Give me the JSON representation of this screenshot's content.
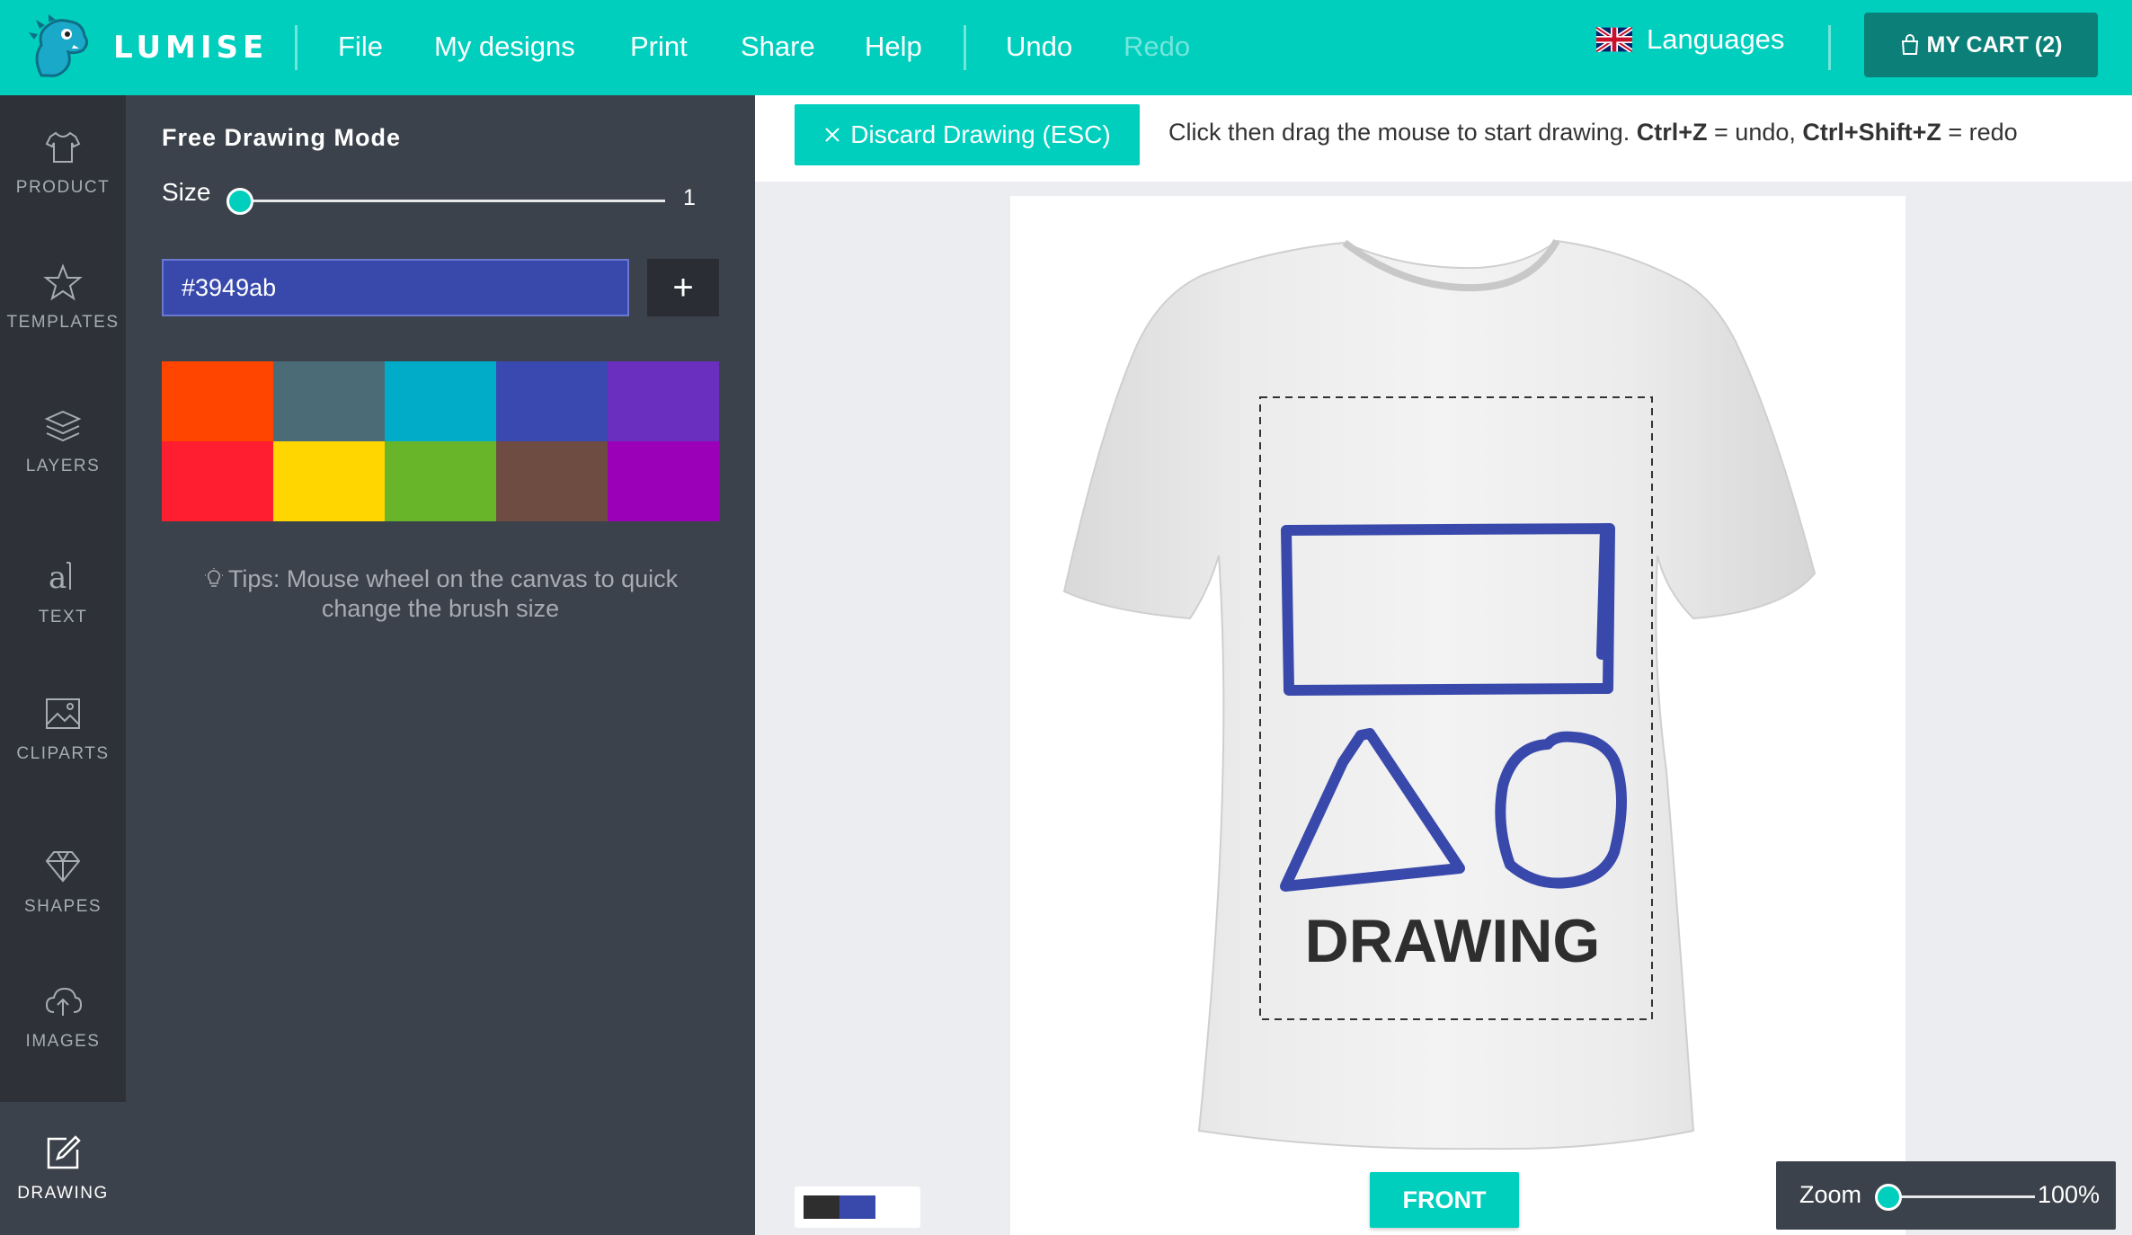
{
  "app": {
    "name": "LUMISE"
  },
  "topbar": {
    "menu": [
      "File",
      "My designs",
      "Print",
      "Share",
      "Help"
    ],
    "undo": "Undo",
    "redo": "Redo",
    "languages": "Languages",
    "cart": "MY CART (2)"
  },
  "leftnav": {
    "product": "PRODUCT",
    "templates": "TEMPLATES",
    "layers": "LAYERS",
    "text": "TEXT",
    "cliparts": "CLIPARTS",
    "shapes": "SHAPES",
    "images": "IMAGES",
    "drawing": "DRAWING"
  },
  "panel": {
    "title": "Free Drawing Mode",
    "size_label": "Size",
    "size_value": "1",
    "color_value": "#3949ab",
    "add_label": "+",
    "swatches": [
      "#ff4500",
      "#4b6b76",
      "#00acc8",
      "#3a49b0",
      "#6a2fbf",
      "#ff1e2f",
      "#ffd600",
      "#68b52a",
      "#6e4c41",
      "#9b00b8"
    ],
    "tips": "Tips: Mouse wheel on the canvas to quick change the brush size"
  },
  "drawbar": {
    "discard": "Discard Drawing (ESC)",
    "hint_prefix": "Click then drag the mouse to start drawing. ",
    "hint_undo_key": "Ctrl+Z",
    "hint_undo": " = undo, ",
    "hint_redo_key": "Ctrl+Shift+Z",
    "hint_redo": " = redo"
  },
  "canvas": {
    "design_text": "DRAWING",
    "stroke_color": "#3949ab",
    "view_button": "FRONT"
  },
  "mini_colors": [
    "#2e2e2e",
    "#3949ab"
  ],
  "zoom": {
    "label": "Zoom",
    "value": "100%",
    "level": 0
  }
}
